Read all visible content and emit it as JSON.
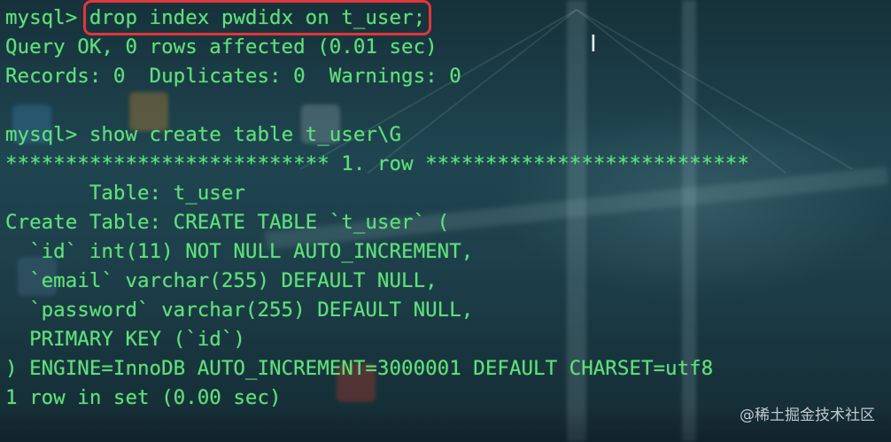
{
  "terminal": {
    "prompt": "mysql>",
    "lines": [
      {
        "prompt": "mysql>",
        "command": "drop index pwdidx on t_user;"
      },
      {
        "text": "Query OK, 0 rows affected (0.01 sec)"
      },
      {
        "text": "Records: 0  Duplicates: 0  Warnings: 0"
      },
      {
        "text": ""
      },
      {
        "prompt": "mysql>",
        "command": "show create table t_user\\G"
      },
      {
        "text": "*************************** 1. row ***************************"
      },
      {
        "text": "       Table: t_user"
      },
      {
        "text": "Create Table: CREATE TABLE `t_user` ("
      },
      {
        "text": "  `id` int(11) NOT NULL AUTO_INCREMENT,"
      },
      {
        "text": "  `email` varchar(255) DEFAULT NULL,"
      },
      {
        "text": "  `password` varchar(255) DEFAULT NULL,"
      },
      {
        "text": "  PRIMARY KEY (`id`)"
      },
      {
        "text": ") ENGINE=InnoDB AUTO_INCREMENT=3000001 DEFAULT CHARSET=utf8"
      },
      {
        "text": "1 row in set (0.00 sec)"
      }
    ]
  },
  "highlight": {
    "color": "#e2363b",
    "target": "drop index pwdidx on t_user;"
  },
  "colors": {
    "terminal_text": "#5ee07a",
    "background": "#1f4550"
  },
  "cursor_icon": "text-cursor-ibeam-icon",
  "watermark": "@稀土掘金技术社区"
}
